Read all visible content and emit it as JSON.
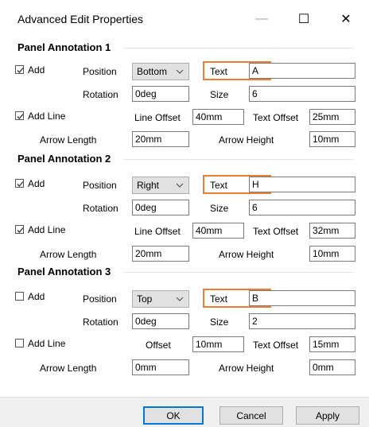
{
  "window": {
    "title": "Advanced Edit Properties",
    "minimize_glyph": "—",
    "maximize_glyph": "☐",
    "close_glyph": "✕"
  },
  "labels": {
    "add": "Add",
    "add_line": "Add Line",
    "position": "Position",
    "rotation": "Rotation",
    "text": "Text",
    "size": "Size",
    "line_offset": "Line Offset",
    "offset": "Offset",
    "text_offset": "Text Offset",
    "arrow_length": "Arrow Length",
    "arrow_height": "Arrow Height"
  },
  "panels": [
    {
      "title": "Panel Annotation 1",
      "add_checked": true,
      "position": "Bottom",
      "text": "A",
      "rotation": "0deg",
      "size": "6",
      "add_line_checked": true,
      "line_offset": "40mm",
      "text_offset": "25mm",
      "arrow_length": "20mm",
      "arrow_height": "10mm"
    },
    {
      "title": "Panel Annotation 2",
      "add_checked": true,
      "position": "Right",
      "text": "H",
      "rotation": "0deg",
      "size": "6",
      "add_line_checked": true,
      "line_offset": "40mm",
      "text_offset": "32mm",
      "arrow_length": "20mm",
      "arrow_height": "10mm"
    },
    {
      "title": "Panel Annotation 3",
      "add_checked": false,
      "position": "Top",
      "text": "B",
      "rotation": "0deg",
      "size": "2",
      "add_line_checked": false,
      "line_offset": "10mm",
      "text_offset": "15mm",
      "arrow_length": "0mm",
      "arrow_height": "0mm"
    }
  ],
  "buttons": {
    "ok": "OK",
    "cancel": "Cancel",
    "apply": "Apply"
  },
  "colors": {
    "highlight": "#ed7d31",
    "focus": "#0078d7"
  }
}
